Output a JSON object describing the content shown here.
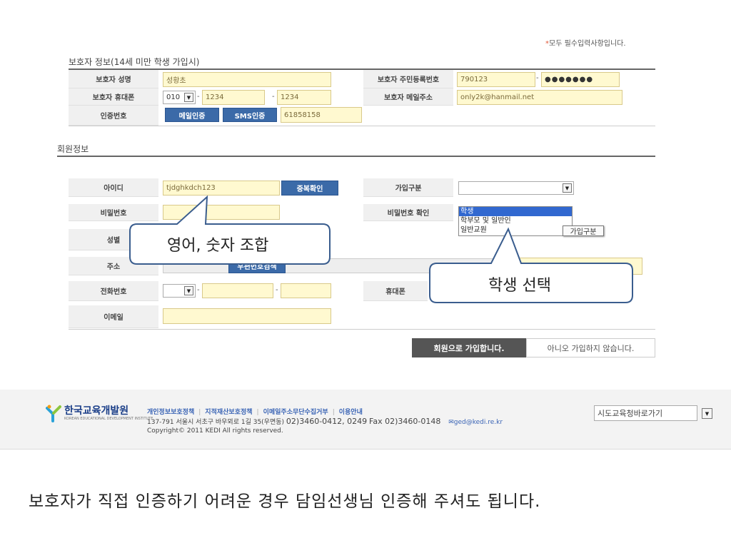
{
  "required_note": {
    "star": "*",
    "text": "모두 필수입력사항입니다."
  },
  "guardian_section": {
    "title": "보호자 정보(14세 미만 학생 가입시)",
    "name_label": "보호자 성명",
    "name_value": "성황초",
    "rrn_label": "보호자 주민등록번호",
    "rrn_front": "790123",
    "rrn_back": "●●●●●●●",
    "phone_label": "보호자 휴대폰",
    "phone_prefix": "010",
    "phone_mid": "1234",
    "phone_last": "1234",
    "email_label": "보호자 메일주소",
    "email_value": "only2k@hanmail.net",
    "auth_label": "인증번호",
    "mail_auth_btn": "메일인증",
    "sms_auth_btn": "SMS인증",
    "auth_code": "61858158"
  },
  "member_section": {
    "title": "회원정보",
    "id_label": "아이디",
    "id_value": "tjdghkdch123",
    "dup_check_btn": "중복확인",
    "join_type_label": "가입구분",
    "join_type_value": "",
    "join_type_options": [
      "학생",
      "학부모 및 일반인",
      "일반교원"
    ],
    "join_type_tooltip": "가입구분",
    "password_label": "비밀번호",
    "password_confirm_label": "비밀번호 확인",
    "gender_label": "성별",
    "address_label": "주소",
    "zip_search_btn": "우편번호검색",
    "tel_label": "전화번호",
    "mobile_label": "휴대폰",
    "email_label": "이메일"
  },
  "callouts": {
    "id_hint": "영어, 숫자 조합",
    "type_hint": "학생 선택"
  },
  "actions": {
    "submit": "회원으로 가입합니다.",
    "cancel": "아니오 가입하지 않습니다."
  },
  "footer": {
    "org_name": "한국교육개발원",
    "org_name_en": "KOREAN EDUCATIONAL DEVELOPMENT INSTITUTE",
    "links": [
      "개인정보보호정책",
      "지적재산보호정책",
      "이메일주소무단수집거부",
      "이용안내"
    ],
    "address": "137-791 서울시 서초구 바우뫼로 1길 35(우면동)",
    "phone": "02)3460-0412, 0249",
    "fax": "Fax 02)3460-0148",
    "email": "ged@kedi.re.kr",
    "copyright": "Copyright© 2011 KEDI All rights reserved.",
    "office_select": "시도교육청바로가기"
  },
  "caption": "보호자가 직접 인증하기 어려운 경우 담임선생님 인증해 주셔도 됩니다.",
  "colors": {
    "input_bg": "#fff9d0",
    "button_blue": "#3b6aa8",
    "submit_bg": "#555555",
    "selected_option": "#3168d0",
    "link_blue": "#3a64b5"
  }
}
